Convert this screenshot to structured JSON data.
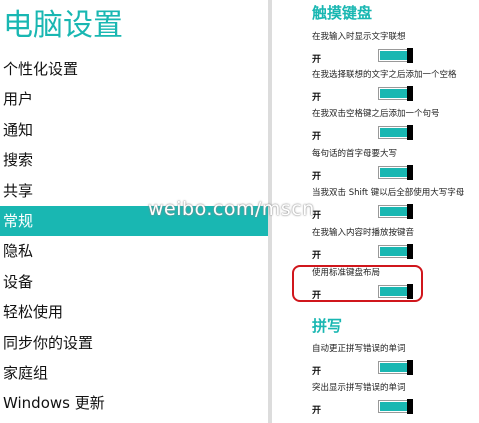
{
  "left_panel": {
    "title": "电脑设置",
    "nav_items": [
      {
        "label": "个性化设置",
        "selected": false
      },
      {
        "label": "用户",
        "selected": false
      },
      {
        "label": "通知",
        "selected": false
      },
      {
        "label": "搜索",
        "selected": false
      },
      {
        "label": "共享",
        "selected": false
      },
      {
        "label": "常规",
        "selected": true
      },
      {
        "label": "隐私",
        "selected": false
      },
      {
        "label": "设备",
        "selected": false
      },
      {
        "label": "轻松使用",
        "selected": false
      },
      {
        "label": "同步你的设置",
        "selected": false
      },
      {
        "label": "家庭组",
        "selected": false
      },
      {
        "label": "Windows 更新",
        "selected": false
      }
    ]
  },
  "right_panel": {
    "touch_keyboard": {
      "title": "触摸键盘",
      "settings": [
        {
          "label": "在我输入时显示文字联想",
          "state": "开",
          "on": true
        },
        {
          "label": "在我选择联想的文字之后添加一个空格",
          "state": "开",
          "on": true
        },
        {
          "label": "在我双击空格键之后添加一个句号",
          "state": "开",
          "on": true
        },
        {
          "label": "每句话的首字母要大写",
          "state": "开",
          "on": true
        },
        {
          "label": "当我双击 Shift 键以后全部使用大写字母",
          "state": "开",
          "on": true
        },
        {
          "label": "在我输入内容时播放按键音",
          "state": "开",
          "on": true
        },
        {
          "label": "使用标准键盘布局",
          "state": "开",
          "on": true
        }
      ]
    },
    "spelling": {
      "title": "拼写",
      "settings": [
        {
          "label": "自动更正拼写错误的单词",
          "state": "开",
          "on": true
        },
        {
          "label": "突出显示拼写错误的单词",
          "state": "开",
          "on": true
        }
      ]
    }
  },
  "watermark": "weibo.com/mscn",
  "colors": {
    "accent": "#19b7b2",
    "highlight_border": "#d0161c"
  }
}
